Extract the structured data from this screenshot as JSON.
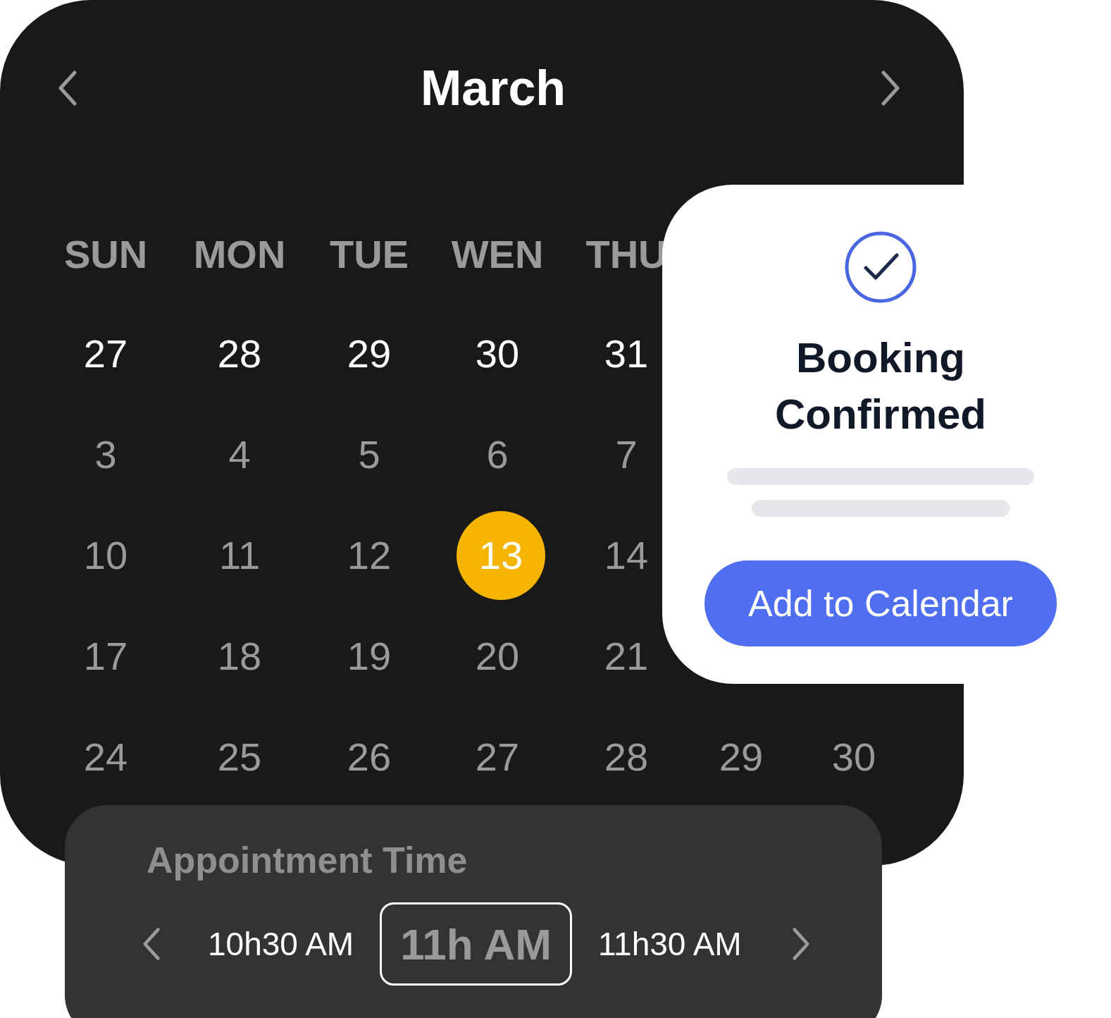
{
  "calendar": {
    "month": "March",
    "weekdays": [
      "SUN",
      "MON",
      "TUE",
      "WEN",
      "THU"
    ],
    "weeks": [
      [
        {
          "day": "27",
          "dimmed": false,
          "selected": false
        },
        {
          "day": "28",
          "dimmed": false,
          "selected": false
        },
        {
          "day": "29",
          "dimmed": false,
          "selected": false
        },
        {
          "day": "30",
          "dimmed": false,
          "selected": false
        },
        {
          "day": "31",
          "dimmed": false,
          "selected": false
        }
      ],
      [
        {
          "day": "3",
          "dimmed": true,
          "selected": false
        },
        {
          "day": "4",
          "dimmed": true,
          "selected": false
        },
        {
          "day": "5",
          "dimmed": true,
          "selected": false
        },
        {
          "day": "6",
          "dimmed": true,
          "selected": false
        },
        {
          "day": "7",
          "dimmed": true,
          "selected": false
        }
      ],
      [
        {
          "day": "10",
          "dimmed": true,
          "selected": false
        },
        {
          "day": "11",
          "dimmed": true,
          "selected": false
        },
        {
          "day": "12",
          "dimmed": true,
          "selected": false
        },
        {
          "day": "13",
          "dimmed": false,
          "selected": true
        },
        {
          "day": "14",
          "dimmed": true,
          "selected": false
        }
      ],
      [
        {
          "day": "17",
          "dimmed": true,
          "selected": false
        },
        {
          "day": "18",
          "dimmed": true,
          "selected": false
        },
        {
          "day": "19",
          "dimmed": true,
          "selected": false
        },
        {
          "day": "20",
          "dimmed": true,
          "selected": false
        },
        {
          "day": "21",
          "dimmed": true,
          "selected": false
        }
      ],
      [
        {
          "day": "24",
          "dimmed": true,
          "selected": false
        },
        {
          "day": "25",
          "dimmed": true,
          "selected": false
        },
        {
          "day": "26",
          "dimmed": true,
          "selected": false
        },
        {
          "day": "27",
          "dimmed": true,
          "selected": false
        },
        {
          "day": "28",
          "dimmed": true,
          "selected": false
        },
        {
          "day": "29",
          "dimmed": true,
          "selected": false
        },
        {
          "day": "30",
          "dimmed": true,
          "selected": false
        }
      ]
    ]
  },
  "confirmation": {
    "title": "Booking Confirmed",
    "button": "Add to Calendar"
  },
  "appointment": {
    "title": "Appointment Time",
    "slots": [
      {
        "label": "10h30 AM",
        "selected": false
      },
      {
        "label": "11h AM",
        "selected": true
      },
      {
        "label": "11h30 AM",
        "selected": false
      }
    ]
  }
}
